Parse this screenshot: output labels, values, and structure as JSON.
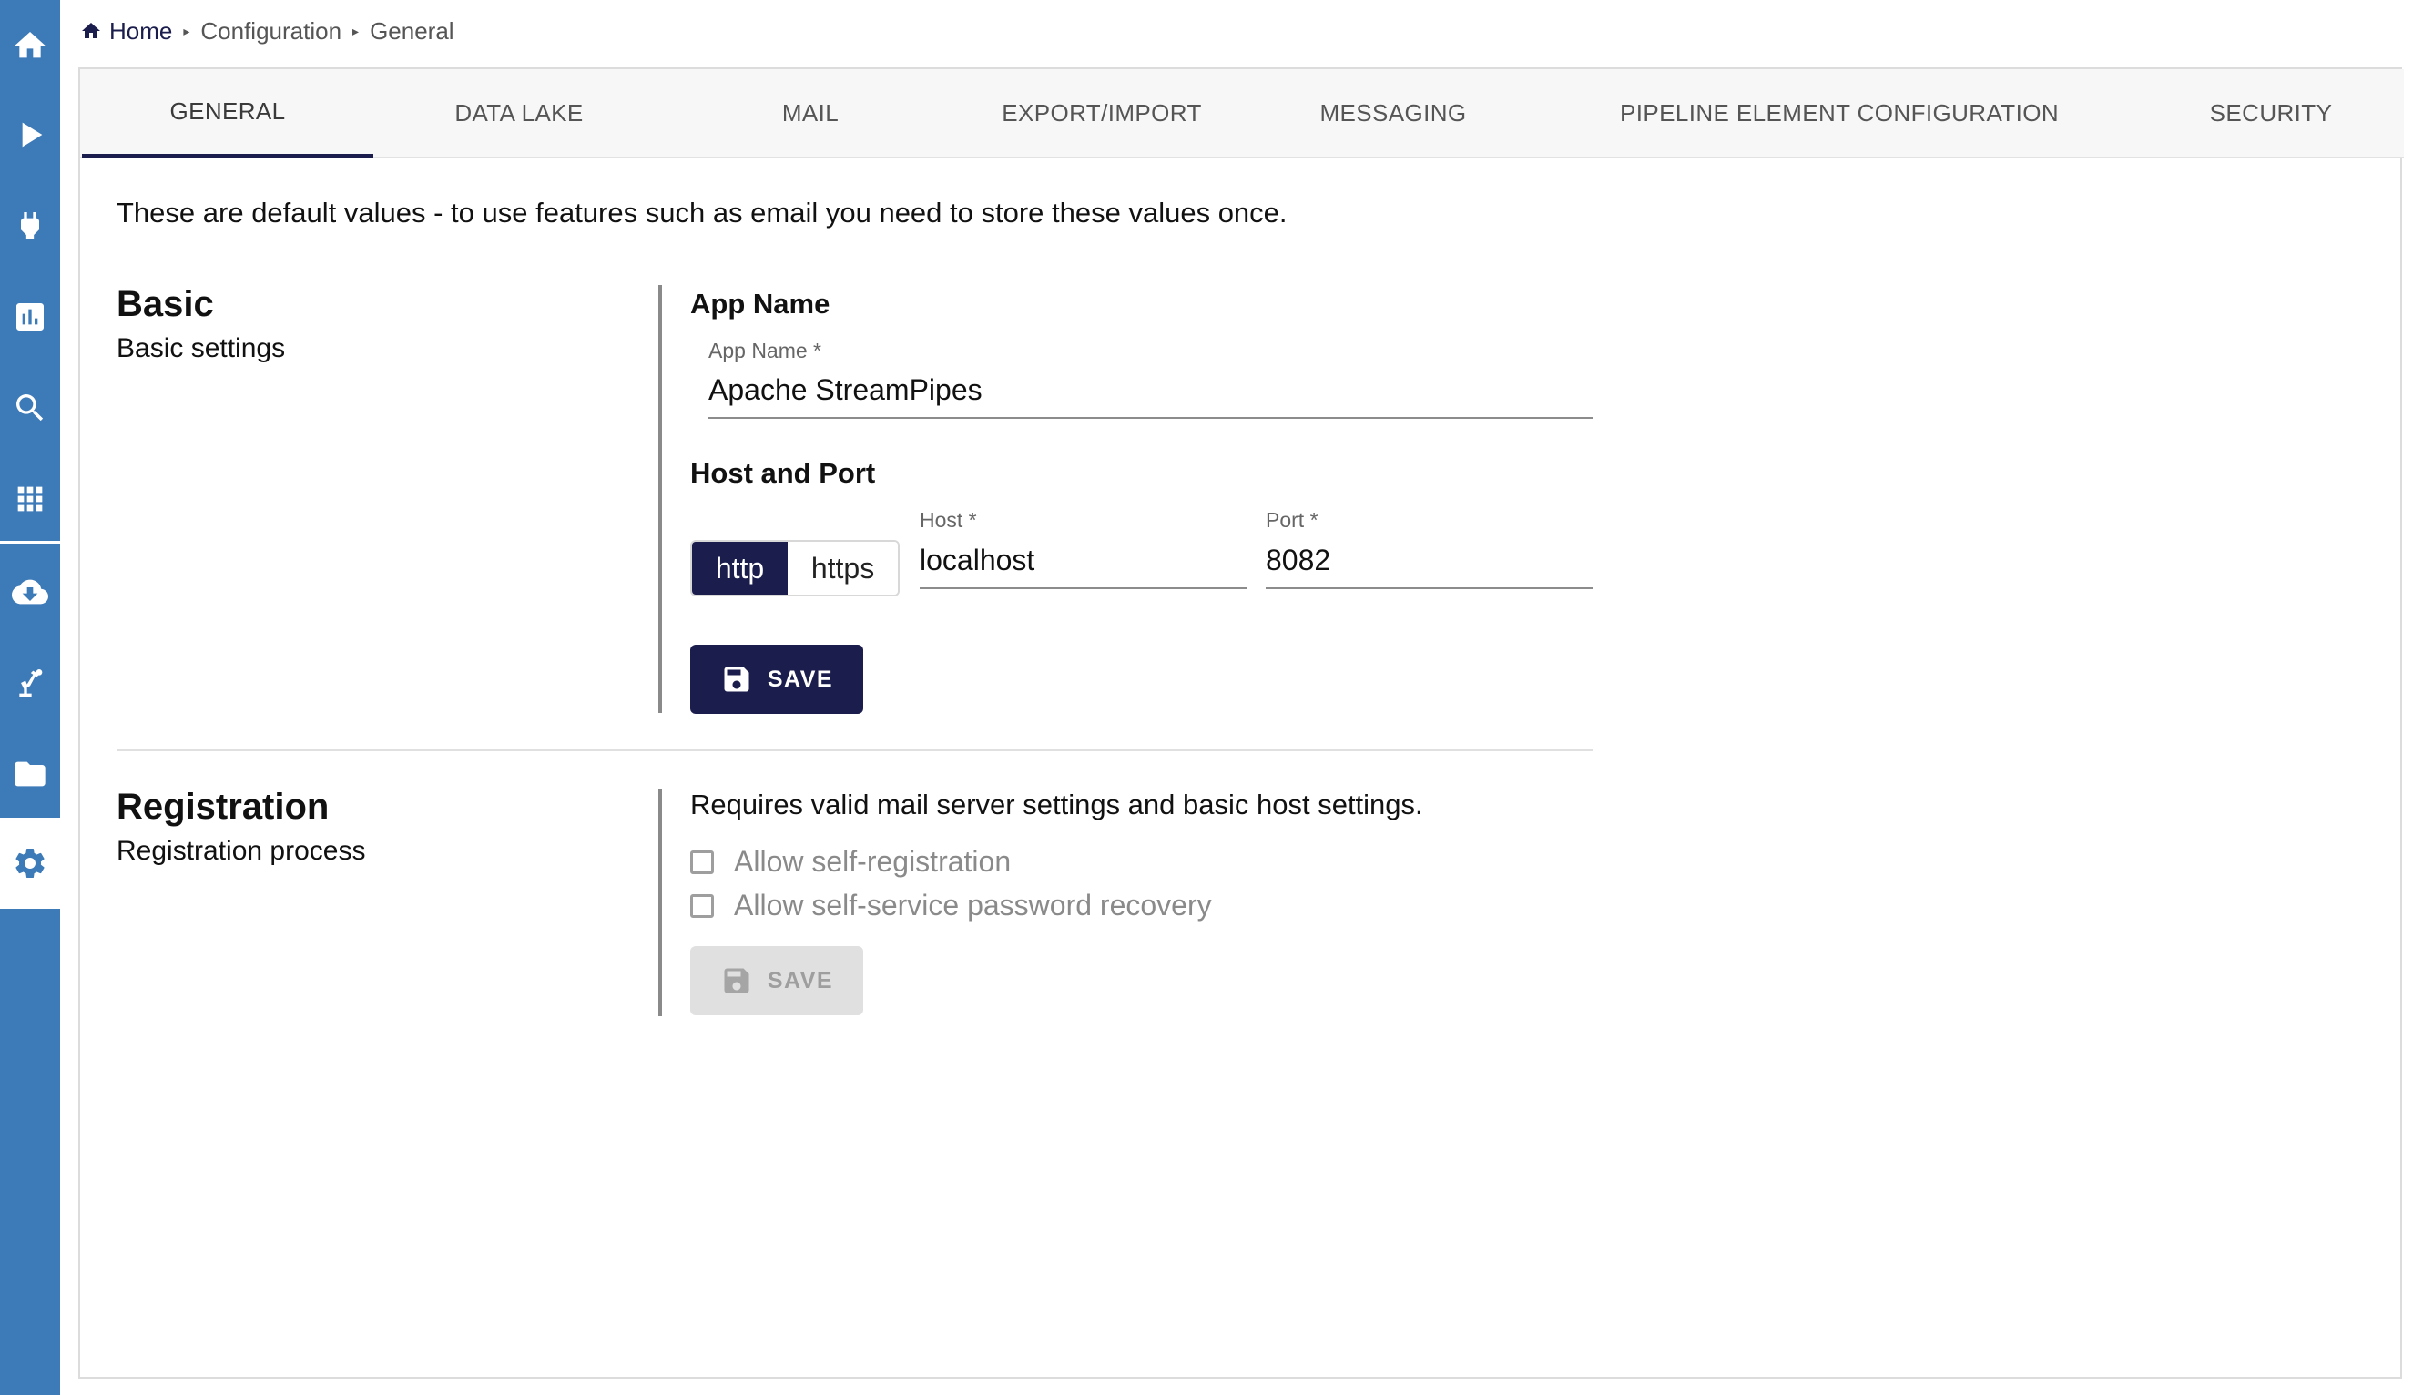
{
  "sidebar": {
    "items": [
      {
        "icon": "home-icon"
      },
      {
        "icon": "play-icon"
      },
      {
        "icon": "plug-icon"
      },
      {
        "icon": "bar-chart-icon"
      },
      {
        "icon": "search-icon"
      },
      {
        "icon": "apps-grid-icon"
      },
      {
        "icon": "cloud-download-icon"
      },
      {
        "icon": "robot-arm-icon"
      },
      {
        "icon": "folder-icon"
      },
      {
        "icon": "gear-icon",
        "active": true
      }
    ],
    "background": "#3c7ab8"
  },
  "breadcrumb": {
    "home": "Home",
    "level1": "Configuration",
    "level2": "General"
  },
  "tabs": [
    {
      "label": "GENERAL",
      "active": true
    },
    {
      "label": "DATA LAKE"
    },
    {
      "label": "MAIL"
    },
    {
      "label": "EXPORT/IMPORT"
    },
    {
      "label": "MESSAGING"
    },
    {
      "label": "PIPELINE ELEMENT CONFIGURATION"
    },
    {
      "label": "SECURITY"
    }
  ],
  "intro_text": "These are default values - to use features such as email you need to store these values once.",
  "basic": {
    "title": "Basic",
    "subtitle": "Basic settings",
    "app_name_heading": "App Name",
    "app_name_label": "App Name *",
    "app_name_value": "Apache StreamPipes",
    "host_port_heading": "Host and Port",
    "protocol_options": [
      "http",
      "https"
    ],
    "protocol_selected": "http",
    "host_label": "Host *",
    "host_value": "localhost",
    "port_label": "Port *",
    "port_value": "8082",
    "save_label": "SAVE"
  },
  "registration": {
    "title": "Registration",
    "subtitle": "Registration process",
    "note": "Requires valid mail server settings and basic host settings.",
    "allow_self_registration": "Allow self-registration",
    "allow_password_recovery": "Allow self-service password recovery",
    "self_registration_checked": false,
    "password_recovery_checked": false,
    "save_label": "SAVE"
  },
  "colors": {
    "accent": "#1b1e4d",
    "sidebar": "#3c7ab8",
    "disabled": "#e0e0e0"
  }
}
